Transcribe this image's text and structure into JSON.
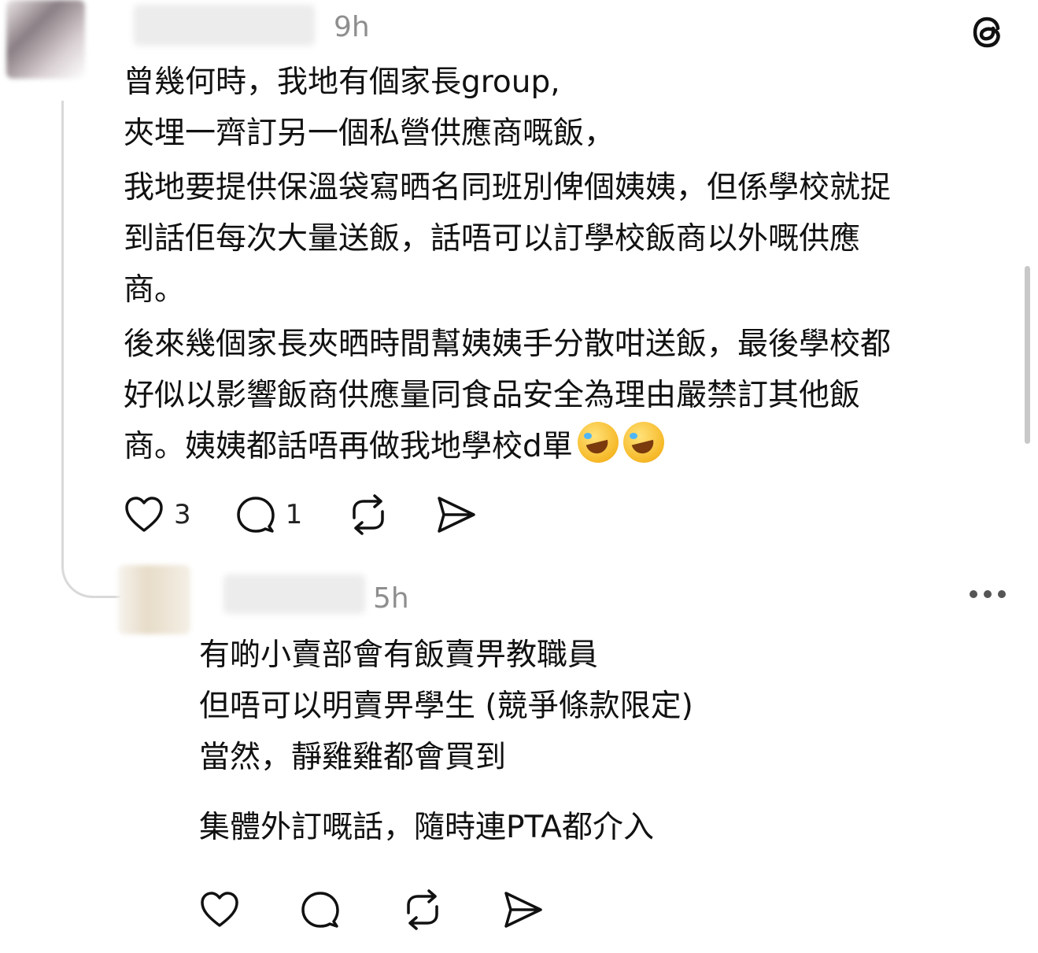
{
  "app": {
    "logo_icon": "threads-logo-icon"
  },
  "comment1": {
    "time": "9h",
    "lines": [
      "曾幾何時，我地有個家長group,",
      "夾埋一齊訂另一個私營供應商嘅飯，",
      "我地要提供保溫袋寫晒名同班別俾個姨姨，但係學校就捉",
      "到話佢每次大量送飯，話唔可以訂學校飯商以外嘅供應",
      "商。",
      "後來幾個家長夾晒時間幫姨姨手分散咁送飯，最後學校都",
      "好似以影響飯商供應量同食品安全為理由嚴禁訂其他飯",
      "商。姨姨都話唔再做我地學校d單"
    ],
    "emoji": "rolling-on-floor-laughing-emoji",
    "likes": "3",
    "replies": "1"
  },
  "comment2": {
    "time": "5h",
    "lines": [
      "有啲小賣部會有飯賣畀教職員",
      "但唔可以明賣畀學生 (競爭條款限定)",
      "當然，靜雞雞都會買到",
      "集體外訂嘅話，隨時連PTA都介入"
    ]
  },
  "colors": {
    "text": "#111111",
    "muted": "#8e8e8e",
    "line": "#d9d9d9"
  }
}
